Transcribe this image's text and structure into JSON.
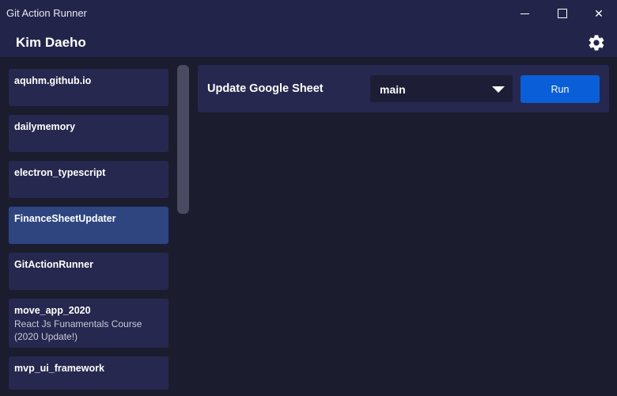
{
  "window": {
    "title": "Git Action Runner",
    "minimize_icon": "minimize-icon",
    "maximize_icon": "maximize-icon",
    "close_icon": "close-icon",
    "close_glyph": "✕"
  },
  "header": {
    "user_name": "Kim Daeho",
    "settings_icon": "gear-icon"
  },
  "sidebar": {
    "repos": [
      {
        "name": "aquhm.github.io",
        "description": ""
      },
      {
        "name": "dailymemory",
        "description": ""
      },
      {
        "name": "electron_typescript",
        "description": ""
      },
      {
        "name": "FinanceSheetUpdater",
        "description": "",
        "selected": true
      },
      {
        "name": "GitActionRunner",
        "description": ""
      },
      {
        "name": "move_app_2020",
        "description": "React Js Funamentals Course (2020 Update!)"
      },
      {
        "name": "mvp_ui_framework",
        "description": ""
      }
    ]
  },
  "workflow": {
    "name": "Update Google Sheet",
    "branch": "main",
    "run_label": "Run"
  },
  "colors": {
    "titlebar": "#23244a",
    "background": "#1b1c2e",
    "card": "#27284f",
    "selected_card": "#2e4580",
    "accent": "#0a5ed7"
  }
}
